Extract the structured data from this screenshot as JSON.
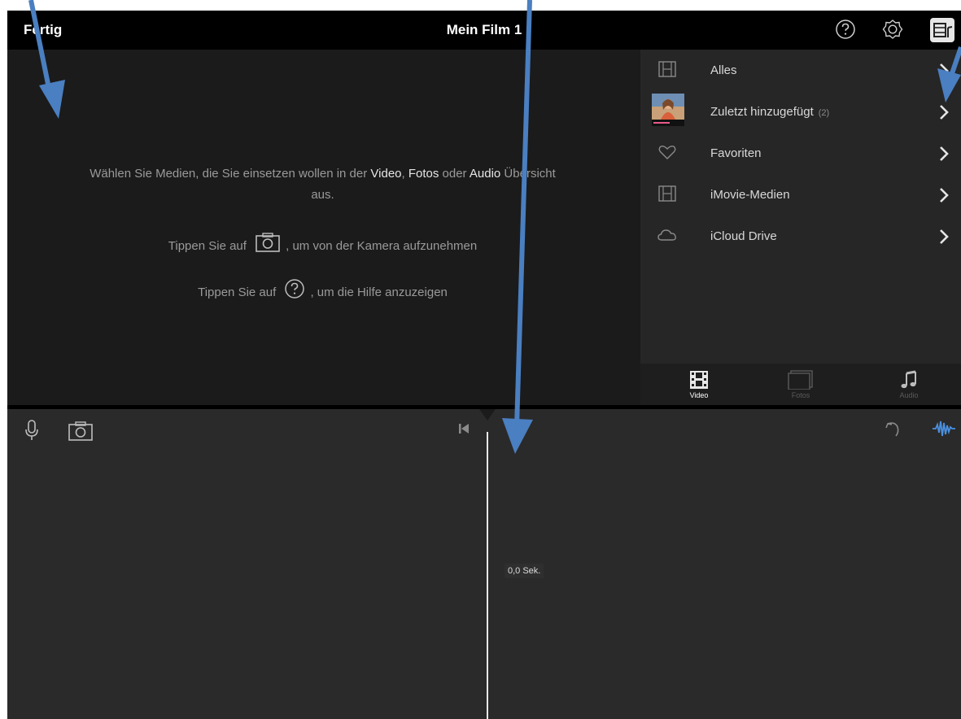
{
  "topbar": {
    "done_label": "Fertig",
    "title": "Mein Film 1",
    "icons": [
      "help-icon",
      "settings-icon",
      "media-audio-icon"
    ]
  },
  "viewer": {
    "line1_pre": "Wählen Sie Medien, die Sie einsetzen wollen in der ",
    "line1_video": "Video",
    "line1_sep": ", ",
    "line1_fotos": "Fotos",
    "line1_oder": " oder ",
    "line1_audio": "Audio",
    "line1_post": " Übersicht",
    "line2": "aus.",
    "camera_pre": "Tippen Sie auf",
    "camera_post": ", um von der Kamera aufzunehmen",
    "help_pre": "Tippen Sie auf",
    "help_post": ", um die Hilfe anzuzeigen"
  },
  "browser": {
    "items": [
      {
        "label": "Alles",
        "icon": "film-icon"
      },
      {
        "label": "Zuletzt hinzugefügt",
        "count": "(2)",
        "icon": "thumbnail"
      },
      {
        "label": "Favoriten",
        "icon": "heart-icon"
      },
      {
        "label": "iMovie-Medien",
        "icon": "film-icon"
      },
      {
        "label": "iCloud Drive",
        "icon": "cloud-icon"
      }
    ],
    "tabs": [
      {
        "label": "Video",
        "icon": "video-tab-icon",
        "active": true
      },
      {
        "label": "Fotos",
        "icon": "photos-tab-icon",
        "active": false
      },
      {
        "label": "Audio",
        "icon": "music-note-icon",
        "active": false
      }
    ]
  },
  "timeline": {
    "duration": "0,0 Sek.",
    "icons": [
      "microphone-icon",
      "camera-icon",
      "rewind-to-start-icon",
      "undo-icon",
      "audio-waveform-icon"
    ]
  },
  "colors": {
    "accent_blue": "#4a90e2",
    "annotation_arrow": "#4a7fc1",
    "topbar": "#000000",
    "viewer_bg": "#1b1b1b",
    "browser_bg": "#262626",
    "timeline_bg": "#2a2a2a"
  }
}
